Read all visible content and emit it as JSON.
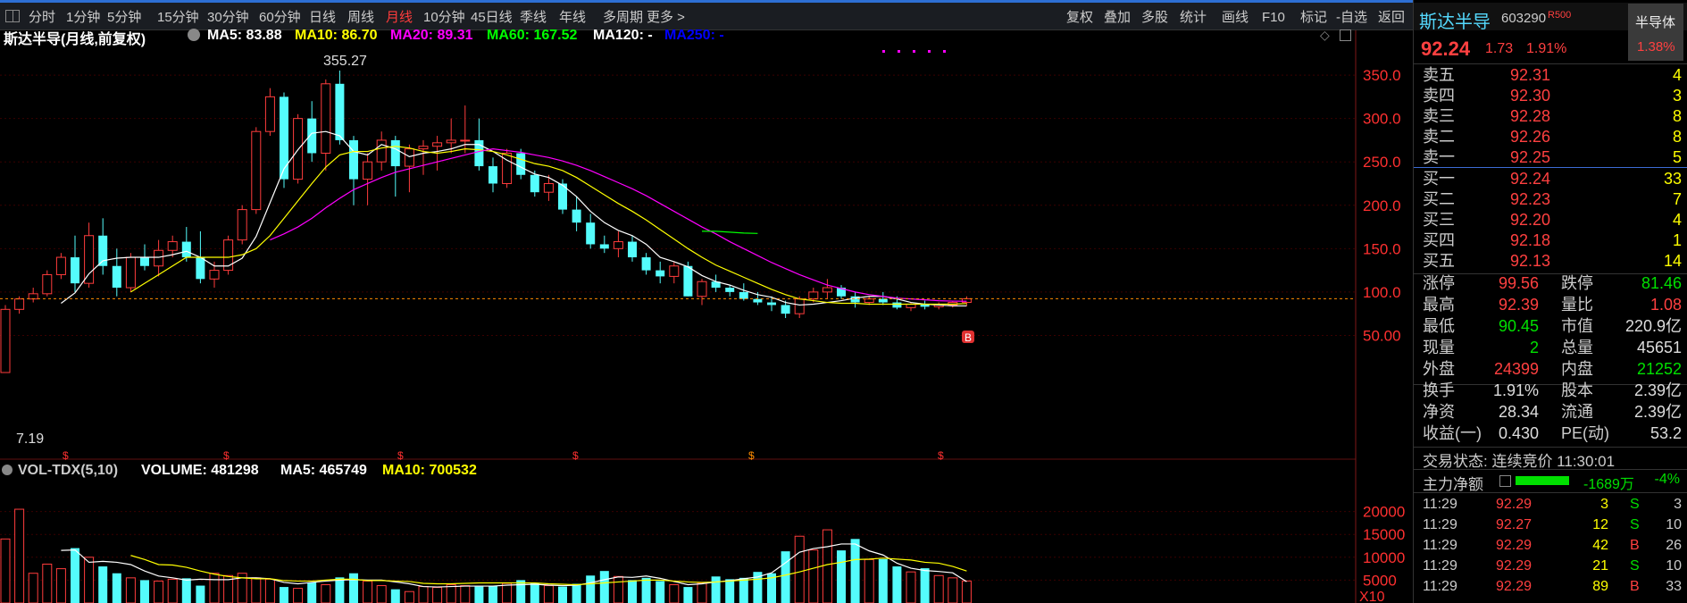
{
  "toolbar": {
    "periods": [
      "分时",
      "1分钟",
      "5分钟",
      "15分钟",
      "30分钟",
      "60分钟",
      "日线",
      "周线",
      "月线",
      "10分钟",
      "45日线",
      "季线",
      "年线",
      "多周期",
      "更多 >"
    ],
    "active_index": 8,
    "tools": [
      "复权",
      "叠加",
      "多股",
      "统计",
      "画线",
      "F10",
      "标记",
      "-自选",
      "返回"
    ]
  },
  "main_chart": {
    "title": "斯达半导(月线,前复权)",
    "ma": [
      {
        "label": "MA5: 83.88",
        "color": "#ffffff"
      },
      {
        "label": "MA10: 86.70",
        "color": "#ffff00"
      },
      {
        "label": "MA20: 89.31",
        "color": "#ff00ff"
      },
      {
        "label": "MA60: 167.52",
        "color": "#00ff00"
      },
      {
        "label": "MA120: -",
        "color": "#ffffff"
      },
      {
        "label": "MA250: -",
        "color": "#0000ff"
      }
    ],
    "high_label": "355.27",
    "low_label": "7.19",
    "buy_marker": "B",
    "s_markers": [
      "$",
      "$",
      "$",
      "$",
      "$",
      "$"
    ]
  },
  "chart_data": {
    "type": "candlestick",
    "price_ticks": [
      350,
      300,
      250,
      200,
      150,
      100,
      50
    ],
    "price_tick_labels": [
      "350.0",
      "300.0",
      "250.0",
      "200.0",
      "150.0",
      "100.0",
      "50.00"
    ],
    "ylim": [
      0,
      375
    ],
    "current_price": 92.24,
    "candles": [
      [
        7.2,
        85,
        7.2,
        80
      ],
      [
        80,
        95,
        75,
        92
      ],
      [
        92,
        105,
        88,
        98
      ],
      [
        98,
        125,
        95,
        120
      ],
      [
        120,
        145,
        115,
        140
      ],
      [
        140,
        165,
        100,
        110
      ],
      [
        110,
        180,
        105,
        165
      ],
      [
        165,
        185,
        120,
        130
      ],
      [
        130,
        150,
        95,
        105
      ],
      [
        105,
        145,
        100,
        140
      ],
      [
        140,
        155,
        125,
        130
      ],
      [
        130,
        160,
        118,
        148
      ],
      [
        148,
        165,
        140,
        158
      ],
      [
        158,
        175,
        135,
        140
      ],
      [
        140,
        170,
        110,
        115
      ],
      [
        115,
        135,
        105,
        125
      ],
      [
        125,
        165,
        120,
        160
      ],
      [
        160,
        200,
        155,
        195
      ],
      [
        195,
        290,
        190,
        285
      ],
      [
        285,
        335,
        280,
        325
      ],
      [
        325,
        330,
        220,
        230
      ],
      [
        230,
        305,
        225,
        300
      ],
      [
        300,
        320,
        250,
        260
      ],
      [
        260,
        345,
        240,
        340
      ],
      [
        340,
        355.27,
        270,
        275
      ],
      [
        275,
        280,
        200,
        230
      ],
      [
        230,
        260,
        200,
        250
      ],
      [
        250,
        285,
        240,
        275
      ],
      [
        275,
        280,
        210,
        245
      ],
      [
        245,
        270,
        215,
        265
      ],
      [
        265,
        275,
        235,
        268
      ],
      [
        268,
        280,
        240,
        272
      ],
      [
        272,
        300,
        260,
        275
      ],
      [
        275,
        315,
        260,
        275
      ],
      [
        275,
        300,
        240,
        245
      ],
      [
        245,
        255,
        215,
        225
      ],
      [
        225,
        265,
        220,
        260
      ],
      [
        260,
        265,
        230,
        235
      ],
      [
        235,
        240,
        210,
        215
      ],
      [
        215,
        235,
        205,
        225
      ],
      [
        225,
        230,
        190,
        195
      ],
      [
        195,
        210,
        170,
        180
      ],
      [
        180,
        190,
        150,
        155
      ],
      [
        155,
        165,
        145,
        150
      ],
      [
        150,
        170,
        140,
        158
      ],
      [
        158,
        165,
        135,
        140
      ],
      [
        140,
        145,
        120,
        125
      ],
      [
        125,
        135,
        110,
        118
      ],
      [
        118,
        135,
        110,
        130
      ],
      [
        130,
        135,
        95,
        95
      ],
      [
        95,
        115,
        85,
        112
      ],
      [
        112,
        120,
        100,
        105
      ],
      [
        105,
        108,
        95,
        100
      ],
      [
        100,
        110,
        90,
        92
      ],
      [
        92,
        100,
        85,
        88
      ],
      [
        88,
        95,
        78,
        85
      ],
      [
        85,
        90,
        70,
        75
      ],
      [
        75,
        95,
        70,
        92
      ],
      [
        92,
        105,
        88,
        100
      ],
      [
        100,
        115,
        92,
        105
      ],
      [
        105,
        108,
        92,
        95
      ],
      [
        95,
        100,
        82,
        88
      ],
      [
        88,
        95,
        85,
        92
      ],
      [
        92,
        100,
        85,
        88
      ],
      [
        88,
        95,
        80,
        82
      ],
      [
        82,
        88,
        78,
        86
      ],
      [
        86,
        90,
        80,
        83
      ],
      [
        83,
        88,
        80,
        85
      ],
      [
        85,
        90,
        82,
        88
      ],
      [
        88,
        95,
        84,
        92.24
      ]
    ],
    "ma5": [
      null,
      null,
      null,
      null,
      87,
      99,
      121,
      136,
      139,
      140,
      140,
      140,
      143,
      147,
      140,
      130,
      130,
      139,
      164,
      203,
      242,
      264,
      283,
      285,
      280,
      262,
      258,
      270,
      265,
      256,
      260,
      262,
      265,
      270,
      270,
      262,
      252,
      244,
      236,
      232,
      223,
      210,
      193,
      180,
      171,
      165,
      155,
      140,
      135,
      129,
      119,
      112,
      108,
      102,
      97,
      94,
      88,
      85,
      86,
      88,
      90,
      93,
      95,
      95,
      92,
      88,
      86,
      85,
      84,
      84
    ],
    "ma10": [
      null,
      null,
      null,
      null,
      null,
      null,
      null,
      null,
      null,
      100,
      110,
      120,
      130,
      140,
      140,
      140,
      140,
      143,
      150,
      165,
      185,
      205,
      225,
      244,
      258,
      262,
      262,
      266,
      268,
      266,
      262,
      260,
      262,
      265,
      264,
      262,
      258,
      253,
      248,
      245,
      240,
      232,
      222,
      212,
      202,
      193,
      183,
      172,
      161,
      150,
      140,
      131,
      124,
      117,
      110,
      103,
      97,
      92,
      90,
      88,
      87,
      87,
      86,
      86,
      86,
      86,
      86,
      86,
      86,
      86.7
    ],
    "ma20": [
      null,
      null,
      null,
      null,
      null,
      null,
      null,
      null,
      null,
      null,
      null,
      null,
      null,
      null,
      null,
      null,
      null,
      null,
      null,
      160,
      167,
      175,
      185,
      197,
      208,
      218,
      225,
      232,
      238,
      242,
      246,
      250,
      254,
      258,
      262,
      265,
      263,
      261,
      258,
      255,
      251,
      246,
      240,
      233,
      226,
      219,
      211,
      202,
      193,
      184,
      175,
      167,
      158,
      150,
      142,
      134,
      127,
      120,
      114,
      108,
      104,
      100,
      97,
      95,
      93,
      92,
      91,
      90,
      89.5,
      89.31
    ],
    "ma60": {
      "start": 66,
      "values": [
        170,
        170,
        169,
        168,
        167.52
      ]
    },
    "volume": {
      "ticks": [
        20000,
        15000,
        10000,
        5000
      ],
      "tick_labels": [
        "20000",
        "15000",
        "10000",
        "5000"
      ],
      "unit_label": "X10",
      "ylim": [
        0,
        21500
      ],
      "values": [
        14000,
        20500,
        6500,
        8500,
        7500,
        12000,
        10000,
        8000,
        6500,
        5500,
        5000,
        4800,
        5200,
        5400,
        3800,
        6500,
        6000,
        6500,
        5500,
        5200,
        3500,
        3200,
        4500,
        4000,
        5600,
        6500,
        4800,
        3800,
        3000,
        2500,
        3600,
        3400,
        4000,
        3800,
        3600,
        3800,
        4300,
        5000,
        4300,
        3800,
        3600,
        4200,
        6000,
        7000,
        5800,
        5000,
        5500,
        4800,
        4000,
        3500,
        4300,
        5800,
        5200,
        5500,
        6800,
        6500,
        11300,
        14600,
        11600,
        16000,
        11500,
        14000,
        9500,
        9600,
        8000,
        6800,
        7600,
        6000,
        5500,
        4813
      ],
      "ma5": [
        null,
        null,
        null,
        null,
        11500,
        11600,
        8900,
        9100,
        8900,
        8400,
        7000,
        5900,
        5500,
        5000,
        5200,
        5100,
        5100,
        5500,
        5500,
        5300,
        4500,
        4200,
        4500,
        4800,
        5000,
        5100,
        5000,
        5000,
        4600,
        4200,
        3600,
        3500,
        3600,
        3700,
        3700,
        3700,
        3900,
        4000,
        4100,
        3900,
        3800,
        3900,
        4400,
        5100,
        5700,
        5600,
        5900,
        5400,
        4700,
        4000,
        4200,
        4600,
        4900,
        5300,
        5700,
        6600,
        8800,
        11100,
        11900,
        12300,
        12900,
        12900,
        11400,
        10500,
        8700,
        7600,
        7100,
        6900,
        6600,
        4657
      ],
      "ma10": [
        null,
        null,
        null,
        null,
        null,
        null,
        null,
        null,
        null,
        10400,
        9500,
        8400,
        8300,
        7800,
        7000,
        6300,
        5800,
        5500,
        5300,
        5300,
        4900,
        4800,
        4800,
        5000,
        5200,
        5200,
        4900,
        4900,
        4800,
        4700,
        4300,
        4200,
        4200,
        4300,
        4400,
        4400,
        4400,
        4400,
        4400,
        4200,
        4100,
        4000,
        4200,
        4400,
        4600,
        4800,
        5000,
        5000,
        4800,
        4600,
        4500,
        4600,
        4800,
        5000,
        5200,
        5500,
        6100,
        6800,
        7600,
        8400,
        8900,
        9500,
        9600,
        9800,
        9600,
        9400,
        8900,
        8700,
        8000,
        7005
      ]
    }
  },
  "volume_chart": {
    "title": "VOL-TDX(5,10)",
    "volume_label": "VOLUME: 481298",
    "ma5_label": "MA5: 465749",
    "ma10_label": "MA10: 700532"
  },
  "quote": {
    "name": "斯达半导",
    "code": "603290",
    "tag": "R500",
    "sector": "半导体",
    "sector_change": "1.38%",
    "price": "92.24",
    "change": "1.73",
    "change_pct": "1.91%",
    "asks": [
      {
        "label": "卖五",
        "price": "92.31",
        "vol": "4"
      },
      {
        "label": "卖四",
        "price": "92.30",
        "vol": "3"
      },
      {
        "label": "卖三",
        "price": "92.28",
        "vol": "8"
      },
      {
        "label": "卖二",
        "price": "92.26",
        "vol": "8"
      },
      {
        "label": "卖一",
        "price": "92.25",
        "vol": "5"
      }
    ],
    "bids": [
      {
        "label": "买一",
        "price": "92.24",
        "vol": "33"
      },
      {
        "label": "买二",
        "price": "92.23",
        "vol": "7"
      },
      {
        "label": "买三",
        "price": "92.20",
        "vol": "4"
      },
      {
        "label": "买四",
        "price": "92.18",
        "vol": "1"
      },
      {
        "label": "买五",
        "price": "92.13",
        "vol": "14"
      }
    ],
    "stats": [
      {
        "l1": "涨停",
        "v1": "99.56",
        "c1": "#ff4040",
        "l2": "跌停",
        "v2": "81.46",
        "c2": "#00e000"
      },
      {
        "l1": "最高",
        "v1": "92.39",
        "c1": "#ff4040",
        "l2": "量比",
        "v2": "1.08",
        "c2": "#ff4040"
      },
      {
        "l1": "最低",
        "v1": "90.45",
        "c1": "#00e000",
        "l2": "市值",
        "v2": "220.9亿",
        "c2": "#dddddd"
      },
      {
        "l1": "现量",
        "v1": "2",
        "c1": "#00e000",
        "l2": "总量",
        "v2": "45651",
        "c2": "#dddddd"
      },
      {
        "l1": "外盘",
        "v1": "24399",
        "c1": "#ff4040",
        "l2": "内盘",
        "v2": "21252",
        "c2": "#00e000"
      }
    ],
    "stats2": [
      {
        "l1": "换手",
        "v1": "1.91%",
        "l2": "股本",
        "v2": "2.39亿"
      },
      {
        "l1": "净资",
        "v1": "28.34",
        "l2": "流通",
        "v2": "2.39亿"
      },
      {
        "l1": "收益(一)",
        "v1": "0.430",
        "l2": "PE(动)",
        "v2": "53.2"
      }
    ],
    "trade_status": "交易状态: 连续竞价 11:30:01",
    "main_flow_label": "主力净额",
    "main_flow_value": "-1689万",
    "main_flow_pct": "-4%",
    "ticks": [
      {
        "time": "11:29",
        "price": "92.29",
        "vol": "3",
        "side": "S",
        "n": "3"
      },
      {
        "time": "11:29",
        "price": "92.27",
        "vol": "12",
        "side": "S",
        "n": "10"
      },
      {
        "time": "11:29",
        "price": "92.29",
        "vol": "42",
        "side": "B",
        "n": "26"
      },
      {
        "time": "11:29",
        "price": "92.29",
        "vol": "21",
        "side": "S",
        "n": "10"
      },
      {
        "time": "11:29",
        "price": "92.29",
        "vol": "89",
        "side": "B",
        "n": "33"
      }
    ]
  },
  "colors": {
    "up": "#ff3c3c",
    "down": "#54fcfc",
    "ma5": "#ffffff",
    "ma10": "#ffff00",
    "ma20": "#ff00ff",
    "ma60": "#00ff00",
    "grid": "#3a0000",
    "axis": "#ff3030"
  }
}
